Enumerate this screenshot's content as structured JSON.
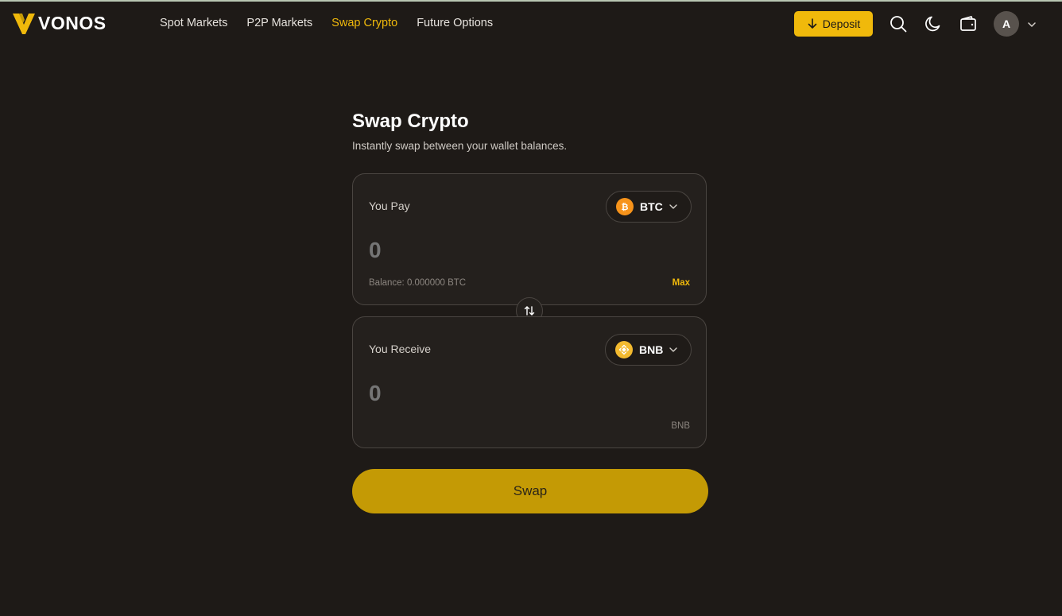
{
  "brand": {
    "name": "VONOS",
    "accent": "#f0b90b"
  },
  "nav": {
    "links": [
      {
        "label": "Spot Markets",
        "active": false
      },
      {
        "label": "P2P Markets",
        "active": false
      },
      {
        "label": "Swap Crypto",
        "active": true
      },
      {
        "label": "Future Options",
        "active": false
      }
    ],
    "deposit_label": "Deposit",
    "icons": [
      "search-icon",
      "moon-icon",
      "wallet-icon"
    ],
    "avatar_initial": "A"
  },
  "page": {
    "title": "Swap Crypto",
    "subtitle": "Instantly swap between your wallet balances."
  },
  "pay": {
    "label": "You Pay",
    "token": "BTC",
    "token_color": "#f7931a",
    "amount_placeholder": "0",
    "balance": "Balance: 0.000000 BTC",
    "max_label": "Max"
  },
  "receive": {
    "label": "You Receive",
    "token": "BNB",
    "token_color": "#f3ba2f",
    "amount_placeholder": "0",
    "unit": "BNB"
  },
  "swap_button": "Swap"
}
